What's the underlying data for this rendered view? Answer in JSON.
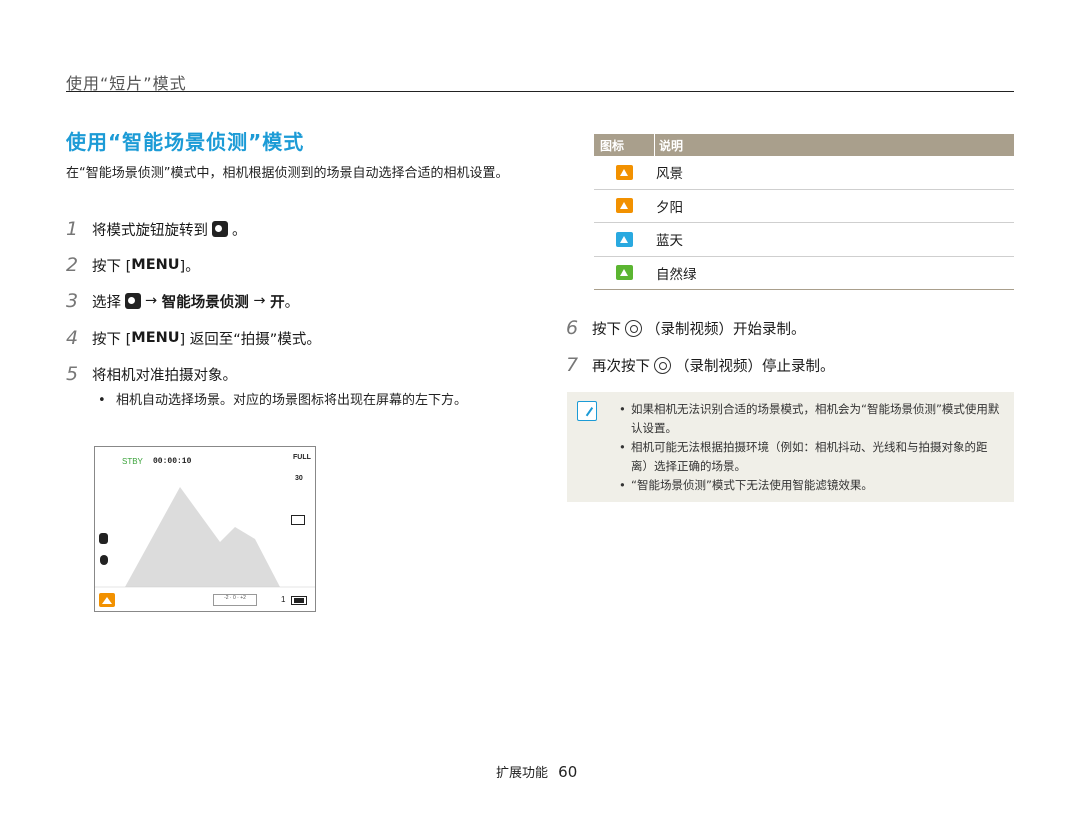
{
  "section_header": "使用“短片”模式",
  "title": "使用“智能场景侦测”模式",
  "intro": "在“智能场景侦测”模式中，相机根据侦测到的场景自动选择合适的相机设置。",
  "steps": [
    {
      "num": "1",
      "pre": "将模式旋钮旋转到",
      "post": "。"
    },
    {
      "num": "2",
      "pre": "按下 [",
      "key": "MENU",
      "post": "]。"
    },
    {
      "num": "3",
      "pre": "选择",
      "arrow1": "→",
      "bold": "智能场景侦测",
      "arrow2": "→",
      "bold2": "开",
      "post": "。"
    },
    {
      "num": "4",
      "pre": "按下 [",
      "key": "MENU",
      "post": "] 返回至“拍摄”模式。"
    },
    {
      "num": "5",
      "pre": "将相机对准拍摄对象。"
    },
    {
      "num": "6",
      "pre": "按下",
      "post": "（录制视频）开始录制。"
    },
    {
      "num": "7",
      "pre": "再次按下",
      "post": "（录制视频）停止录制。"
    }
  ],
  "step5_bullet": "相机自动选择场景。对应的场景图标将出现在屏幕的左下方。",
  "preview": {
    "stby": "STBY",
    "time": "00:00:10",
    "full": "FULL",
    "fps": "30",
    "count": "1",
    "ev_label": "-2 · 0 · +2"
  },
  "table": {
    "col_icon": "图标",
    "col_desc": "说明",
    "rows": [
      {
        "icon": "landscape-icon",
        "color": "#f29100",
        "desc": "风景"
      },
      {
        "icon": "sunset-icon",
        "color": "#f29100",
        "desc": "夕阳"
      },
      {
        "icon": "blue-sky-icon",
        "color": "#29a9e0",
        "desc": "蓝天"
      },
      {
        "icon": "natural-green-icon",
        "color": "#5bb531",
        "desc": "自然绿"
      }
    ]
  },
  "notes": [
    "如果相机无法识别合适的场景模式，相机会为“智能场景侦测”模式使用默认设置。",
    "相机可能无法根据拍摄环境（例如：相机抖动、光线和与拍摄对象的距离）选择正确的场景。",
    "“智能场景侦测”模式下无法使用智能滤镜效果。"
  ],
  "footer": {
    "label": "扩展功能",
    "page": "60"
  },
  "colors": {
    "accent": "#1c9bd6",
    "table_header": "#a99f8c",
    "note_bg": "#f0efe8"
  }
}
